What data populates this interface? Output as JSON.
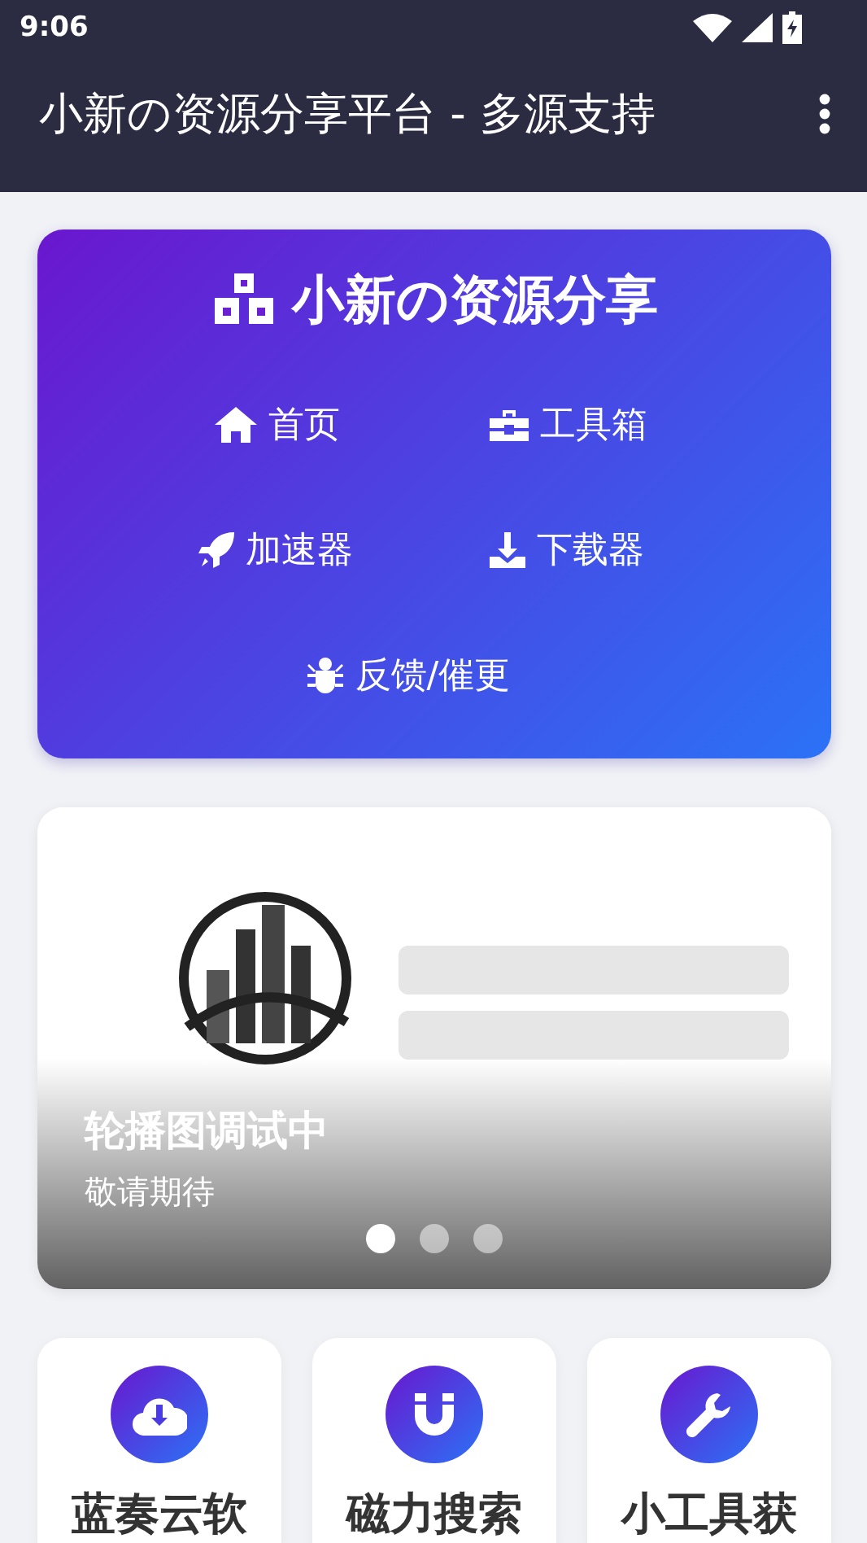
{
  "status_bar": {
    "time": "9:06"
  },
  "app_bar": {
    "title": "小新の资源分享平台 - 多源支持"
  },
  "hero": {
    "title": "小新の资源分享",
    "nav": [
      {
        "label": "首页"
      },
      {
        "label": "工具箱"
      },
      {
        "label": "加速器"
      },
      {
        "label": "下载器"
      },
      {
        "label": "反馈/催更"
      }
    ]
  },
  "carousel": {
    "caption_title": "轮播图调试中",
    "caption_subtitle": "敬请期待",
    "dots": [
      {
        "selected": true
      },
      {
        "selected": false
      },
      {
        "selected": false
      }
    ]
  },
  "features": [
    {
      "label": "蓝奏云软"
    },
    {
      "label": "磁力搜索"
    },
    {
      "label": "小工具获"
    }
  ]
}
